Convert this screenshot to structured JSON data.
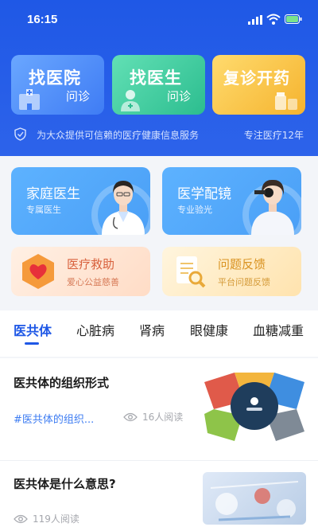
{
  "status_bar": {
    "time": "16:15"
  },
  "quick_actions": [
    {
      "title": "找医院",
      "subtitle": "问诊"
    },
    {
      "title": "找医生",
      "subtitle": "问诊"
    },
    {
      "title": "复诊开药",
      "subtitle": ""
    }
  ],
  "trust_bar": {
    "text": "为大众提供可信赖的医疗健康信息服务",
    "right": "专注医疗12年"
  },
  "services": [
    {
      "title": "家庭医生",
      "subtitle": "专属医生"
    },
    {
      "title": "医学配镜",
      "subtitle": "专业验光"
    },
    {
      "title": "医疗救助",
      "subtitle": "爱心公益慈善"
    },
    {
      "title": "问题反馈",
      "subtitle": "平台问题反馈"
    }
  ],
  "tabs": [
    "医共体",
    "心脏病",
    "肾病",
    "眼健康",
    "血糖减重"
  ],
  "articles": [
    {
      "title": "医共体的组织形式",
      "tag": "#医共体的组织...",
      "views": "16人阅读"
    },
    {
      "title": "医共体是什么意思?",
      "tag": "",
      "views": "119人阅读"
    }
  ],
  "colors": {
    "primary": "#1f58e6",
    "tag": "#3d7cf2"
  }
}
